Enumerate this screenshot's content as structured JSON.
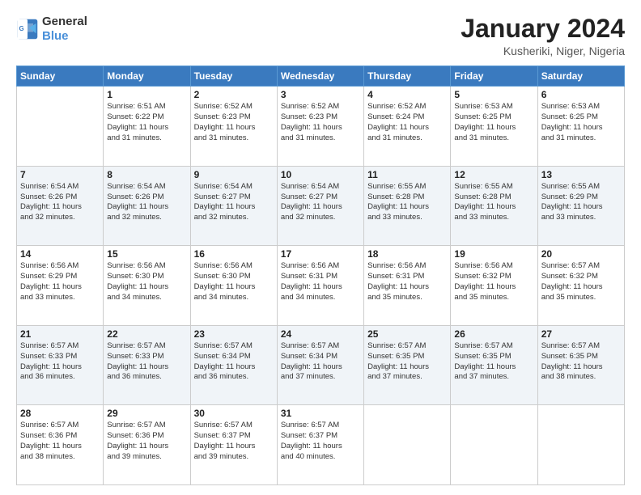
{
  "header": {
    "logo_line1": "General",
    "logo_line2": "Blue",
    "title": "January 2024",
    "subtitle": "Kusheriki, Niger, Nigeria"
  },
  "calendar": {
    "days_of_week": [
      "Sunday",
      "Monday",
      "Tuesday",
      "Wednesday",
      "Thursday",
      "Friday",
      "Saturday"
    ],
    "weeks": [
      [
        {
          "day": "",
          "text": ""
        },
        {
          "day": "1",
          "text": "Sunrise: 6:51 AM\nSunset: 6:22 PM\nDaylight: 11 hours\nand 31 minutes."
        },
        {
          "day": "2",
          "text": "Sunrise: 6:52 AM\nSunset: 6:23 PM\nDaylight: 11 hours\nand 31 minutes."
        },
        {
          "day": "3",
          "text": "Sunrise: 6:52 AM\nSunset: 6:23 PM\nDaylight: 11 hours\nand 31 minutes."
        },
        {
          "day": "4",
          "text": "Sunrise: 6:52 AM\nSunset: 6:24 PM\nDaylight: 11 hours\nand 31 minutes."
        },
        {
          "day": "5",
          "text": "Sunrise: 6:53 AM\nSunset: 6:25 PM\nDaylight: 11 hours\nand 31 minutes."
        },
        {
          "day": "6",
          "text": "Sunrise: 6:53 AM\nSunset: 6:25 PM\nDaylight: 11 hours\nand 31 minutes."
        }
      ],
      [
        {
          "day": "7",
          "text": "Sunrise: 6:54 AM\nSunset: 6:26 PM\nDaylight: 11 hours\nand 32 minutes."
        },
        {
          "day": "8",
          "text": "Sunrise: 6:54 AM\nSunset: 6:26 PM\nDaylight: 11 hours\nand 32 minutes."
        },
        {
          "day": "9",
          "text": "Sunrise: 6:54 AM\nSunset: 6:27 PM\nDaylight: 11 hours\nand 32 minutes."
        },
        {
          "day": "10",
          "text": "Sunrise: 6:54 AM\nSunset: 6:27 PM\nDaylight: 11 hours\nand 32 minutes."
        },
        {
          "day": "11",
          "text": "Sunrise: 6:55 AM\nSunset: 6:28 PM\nDaylight: 11 hours\nand 33 minutes."
        },
        {
          "day": "12",
          "text": "Sunrise: 6:55 AM\nSunset: 6:28 PM\nDaylight: 11 hours\nand 33 minutes."
        },
        {
          "day": "13",
          "text": "Sunrise: 6:55 AM\nSunset: 6:29 PM\nDaylight: 11 hours\nand 33 minutes."
        }
      ],
      [
        {
          "day": "14",
          "text": "Sunrise: 6:56 AM\nSunset: 6:29 PM\nDaylight: 11 hours\nand 33 minutes."
        },
        {
          "day": "15",
          "text": "Sunrise: 6:56 AM\nSunset: 6:30 PM\nDaylight: 11 hours\nand 34 minutes."
        },
        {
          "day": "16",
          "text": "Sunrise: 6:56 AM\nSunset: 6:30 PM\nDaylight: 11 hours\nand 34 minutes."
        },
        {
          "day": "17",
          "text": "Sunrise: 6:56 AM\nSunset: 6:31 PM\nDaylight: 11 hours\nand 34 minutes."
        },
        {
          "day": "18",
          "text": "Sunrise: 6:56 AM\nSunset: 6:31 PM\nDaylight: 11 hours\nand 35 minutes."
        },
        {
          "day": "19",
          "text": "Sunrise: 6:56 AM\nSunset: 6:32 PM\nDaylight: 11 hours\nand 35 minutes."
        },
        {
          "day": "20",
          "text": "Sunrise: 6:57 AM\nSunset: 6:32 PM\nDaylight: 11 hours\nand 35 minutes."
        }
      ],
      [
        {
          "day": "21",
          "text": "Sunrise: 6:57 AM\nSunset: 6:33 PM\nDaylight: 11 hours\nand 36 minutes."
        },
        {
          "day": "22",
          "text": "Sunrise: 6:57 AM\nSunset: 6:33 PM\nDaylight: 11 hours\nand 36 minutes."
        },
        {
          "day": "23",
          "text": "Sunrise: 6:57 AM\nSunset: 6:34 PM\nDaylight: 11 hours\nand 36 minutes."
        },
        {
          "day": "24",
          "text": "Sunrise: 6:57 AM\nSunset: 6:34 PM\nDaylight: 11 hours\nand 37 minutes."
        },
        {
          "day": "25",
          "text": "Sunrise: 6:57 AM\nSunset: 6:35 PM\nDaylight: 11 hours\nand 37 minutes."
        },
        {
          "day": "26",
          "text": "Sunrise: 6:57 AM\nSunset: 6:35 PM\nDaylight: 11 hours\nand 37 minutes."
        },
        {
          "day": "27",
          "text": "Sunrise: 6:57 AM\nSunset: 6:35 PM\nDaylight: 11 hours\nand 38 minutes."
        }
      ],
      [
        {
          "day": "28",
          "text": "Sunrise: 6:57 AM\nSunset: 6:36 PM\nDaylight: 11 hours\nand 38 minutes."
        },
        {
          "day": "29",
          "text": "Sunrise: 6:57 AM\nSunset: 6:36 PM\nDaylight: 11 hours\nand 39 minutes."
        },
        {
          "day": "30",
          "text": "Sunrise: 6:57 AM\nSunset: 6:37 PM\nDaylight: 11 hours\nand 39 minutes."
        },
        {
          "day": "31",
          "text": "Sunrise: 6:57 AM\nSunset: 6:37 PM\nDaylight: 11 hours\nand 40 minutes."
        },
        {
          "day": "",
          "text": ""
        },
        {
          "day": "",
          "text": ""
        },
        {
          "day": "",
          "text": ""
        }
      ]
    ]
  }
}
